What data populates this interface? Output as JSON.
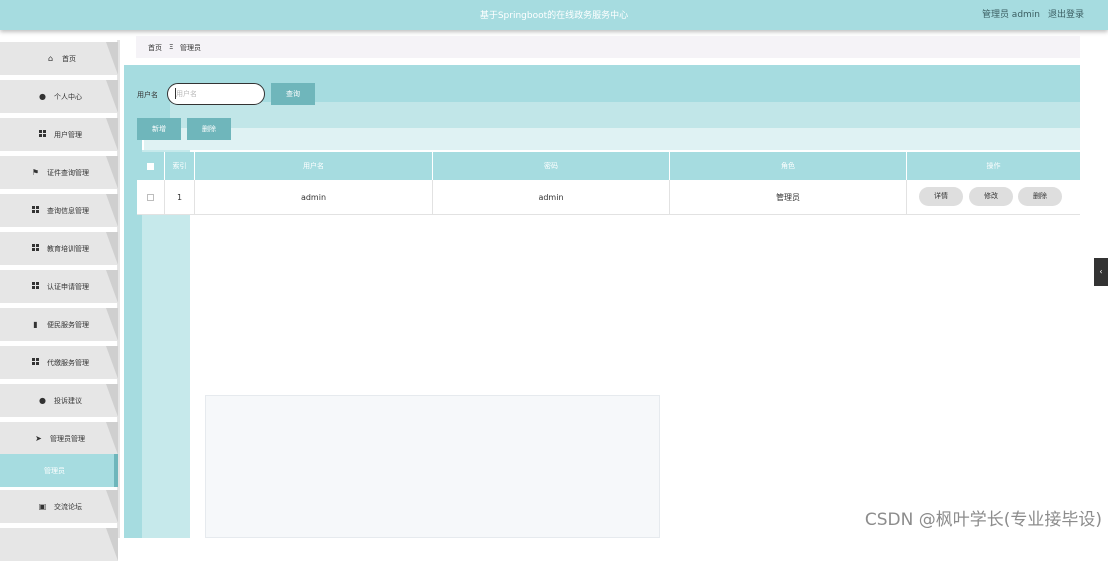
{
  "header": {
    "title": "基于Springboot的在线政务服务中心",
    "user_label": "管理员 admin",
    "logout_label": "退出登录"
  },
  "sidebar": {
    "items": [
      {
        "label": "首页",
        "icon": "home-icon"
      },
      {
        "label": "个人中心",
        "icon": "user-icon"
      },
      {
        "label": "用户管理",
        "icon": "grid-icon"
      },
      {
        "label": "证件查询管理",
        "icon": "flag-icon"
      },
      {
        "label": "查询信息管理",
        "icon": "grid-icon"
      },
      {
        "label": "教育培训管理",
        "icon": "grid-icon"
      },
      {
        "label": "认证申请管理",
        "icon": "grid-icon"
      },
      {
        "label": "便民服务管理",
        "icon": "bar-chart-icon"
      },
      {
        "label": "代缴服务管理",
        "icon": "grid-icon"
      },
      {
        "label": "投诉建议",
        "icon": "user-icon"
      },
      {
        "label": "管理员管理",
        "icon": "send-icon"
      },
      {
        "label": "管理员",
        "icon": "",
        "active": true
      },
      {
        "label": "交流论坛",
        "icon": "clipboard-icon"
      }
    ]
  },
  "breadcrumb": {
    "home": "首页",
    "separator": "Ξ",
    "current": "管理员"
  },
  "search": {
    "label": "用户名",
    "placeholder": "用户名",
    "value": "",
    "query_label": "查询"
  },
  "actions": {
    "add_label": "新增",
    "delete_label": "删除"
  },
  "table": {
    "headers": [
      "",
      "索引",
      "用户名",
      "密码",
      "角色",
      "操作"
    ],
    "rows": [
      {
        "index": "1",
        "username": "admin",
        "password": "admin",
        "role": "管理员"
      }
    ],
    "row_actions": {
      "detail": "详情",
      "edit": "修改",
      "delete": "删除"
    }
  },
  "side_tab_glyph": "‹",
  "watermark": "CSDN @枫叶学长(专业接毕设)",
  "colors": {
    "accent": "#a6dce0",
    "button": "#6fb6bb",
    "active_rail": "#6fb6bb"
  }
}
